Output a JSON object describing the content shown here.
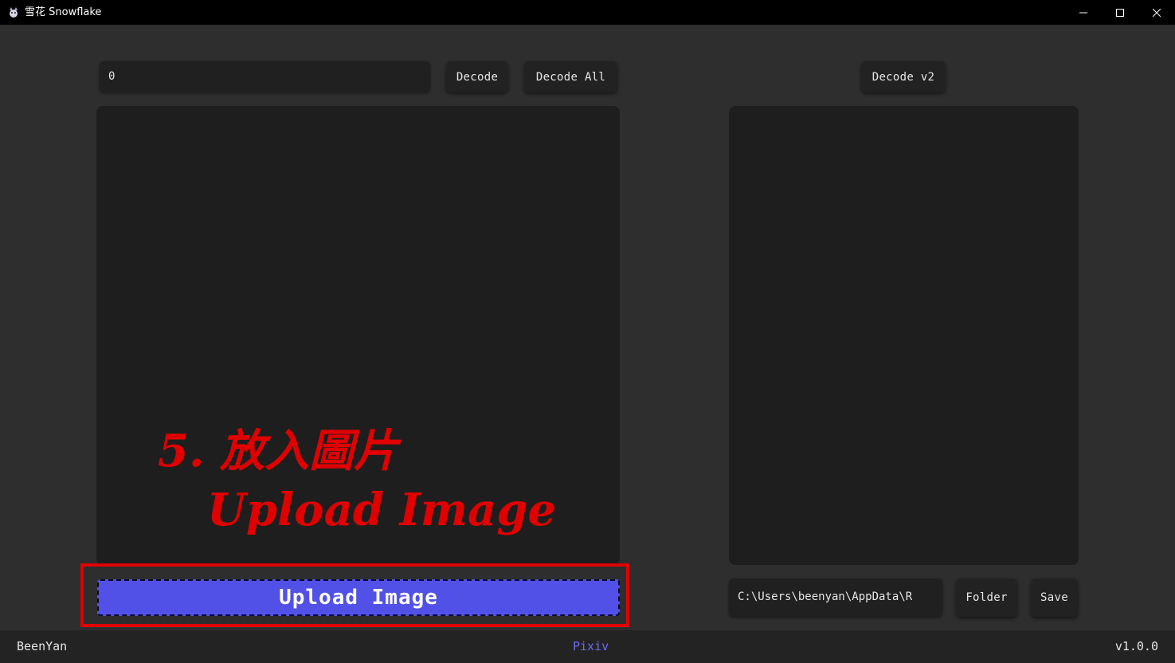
{
  "window": {
    "title": "雪花 Snowflake",
    "controls": [
      "minimize",
      "maximize",
      "close"
    ]
  },
  "left": {
    "number_input_value": "0",
    "decode_label": "Decode",
    "decode_all_label": "Decode All",
    "upload_label": "Upload Image"
  },
  "right": {
    "decode_v2_label": "Decode v2",
    "path_value": "C:\\Users\\beenyan\\AppData\\R",
    "folder_label": "Folder",
    "save_label": "Save"
  },
  "annotation": {
    "line1": "5. 放入圖片",
    "line2": "Upload Image",
    "color": "#e00000"
  },
  "footer": {
    "author": "BeenYan",
    "link": "Pixiv",
    "version": "v1.0.0"
  },
  "colors": {
    "accent": "#5151e8",
    "link": "#6b6bf0",
    "background": "#2e2e2e",
    "panel": "#1e1e1e"
  }
}
